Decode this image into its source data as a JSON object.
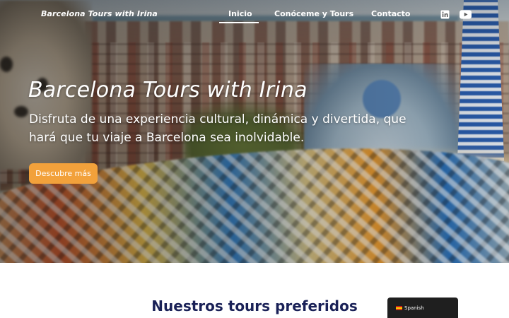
{
  "header": {
    "brand": "Barcelona Tours with Irina",
    "nav": [
      {
        "label": "Inicio",
        "active": true
      },
      {
        "label": "Conóceme y Tours",
        "active": false
      },
      {
        "label": "Contacto",
        "active": false
      }
    ],
    "social": [
      {
        "icon": "linkedin-icon"
      },
      {
        "icon": "youtube-icon"
      }
    ]
  },
  "hero": {
    "title": "Barcelona Tours with Irina",
    "subtitle": "Disfruta de una experiencia cultural, dinámica y divertida, que hará que tu viaje a Barcelona sea inolvidable.",
    "cta_label": "Descubre más"
  },
  "section": {
    "title": "Nuestros tours preferidos"
  },
  "language_switcher": {
    "label": "Spanish",
    "flag": "spain-flag-icon"
  },
  "colors": {
    "cta": "#f2a13b",
    "section_title": "#1a2157",
    "lang_bg": "#1f1f1f"
  }
}
